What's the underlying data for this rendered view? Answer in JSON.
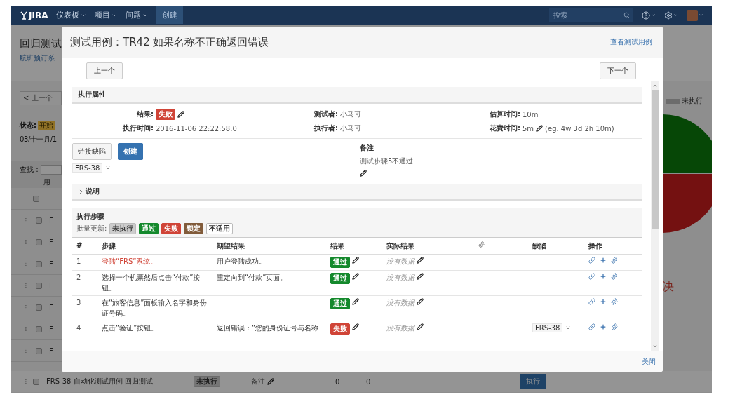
{
  "nav": {
    "logo": "JIRA",
    "menus": [
      {
        "label": "仪表板"
      },
      {
        "label": "项目"
      },
      {
        "label": "问题"
      }
    ],
    "create": "创建",
    "search": {
      "placeholder": "搜索"
    }
  },
  "page": {
    "title": "回归测试",
    "subtitle": "航班预订系",
    "prev": "< 上一个",
    "status_label": "状态:",
    "status": "开始",
    "date": "03/十一月/1",
    "find_label": "查找：",
    "find_hint": "用",
    "header_checked": false,
    "rows": [
      {
        "label": "F",
        "checked": false
      },
      {
        "label": "F",
        "checked": false
      },
      {
        "label": "F",
        "checked": false
      },
      {
        "label": "F",
        "checked": false
      },
      {
        "label": "F",
        "checked": false
      },
      {
        "label": "F",
        "checked": false
      },
      {
        "label": "F",
        "checked": false
      }
    ],
    "last_row": {
      "checked": false,
      "name": "FRS-38 自动化测试用例-回归测试",
      "status": "未执行",
      "note": "备注",
      "count_1": "0",
      "count_2": "0",
      "action": "执行"
    },
    "legend": "未执行",
    "side_text": "决"
  },
  "modal": {
    "title": "测试用例：TR42 如果名称不正确返回错误",
    "view_link": "查看测试用例",
    "prev": "上一个",
    "next": "下一个",
    "attributes": {
      "heading": "执行属性",
      "fields": [
        {
          "label": "结果:",
          "kind": "status",
          "value": "失败",
          "color": "#d04437"
        },
        {
          "label": "测试者:",
          "kind": "text",
          "value": "小马哥"
        },
        {
          "label": "估算时间:",
          "kind": "text",
          "value": "10m"
        },
        {
          "label": "执行时间:",
          "kind": "text",
          "value": "2016-11-06 22:22:58.0"
        },
        {
          "label": "执行者:",
          "kind": "text",
          "value": "小马哥"
        },
        {
          "label": "花费时间:",
          "kind": "editable",
          "value": "5m",
          "hint": "(eg. 4w 3d 2h 10m)"
        }
      ],
      "link_defect": "链接缺陷",
      "create": "创建",
      "defects": [
        "FRS-38"
      ],
      "comment_label": "备注",
      "comment": "测试步骤5不通过"
    },
    "description": {
      "label": "说明",
      "expanded": false
    },
    "steps": {
      "heading": "执行步骤",
      "bulk_label": "批量更新:",
      "bulk": [
        {
          "label": "未执行",
          "color": "#cccccc"
        },
        {
          "label": "通过",
          "color": "#14892c"
        },
        {
          "label": "失败",
          "color": "#d04437"
        },
        {
          "label": "锁定",
          "color": "#815b3a"
        },
        {
          "label": "不适用",
          "color": "#ffffff"
        }
      ],
      "columns": [
        {
          "kind": "text",
          "label": "#"
        },
        {
          "kind": "text",
          "label": "步骤"
        },
        {
          "kind": "text",
          "label": "期望结果"
        },
        {
          "kind": "text",
          "label": "结果"
        },
        {
          "kind": "text",
          "label": "实际结果"
        },
        {
          "kind": "attachment"
        },
        {
          "kind": "text",
          "label": "缺陷"
        },
        {
          "kind": "text",
          "label": "操作"
        }
      ],
      "rows": [
        {
          "number": "1",
          "step": "登陆“FRS”系统。",
          "highlight": true,
          "expected": "用户登陆成功。",
          "result": {
            "label": "通过",
            "color": "#14892c"
          },
          "actual": "没有数据"
        },
        {
          "number": "2",
          "step": "选择一个机票然后点击“付款”按钮。",
          "highlight": false,
          "expected": "重定向到“付款”页面。",
          "result": {
            "label": "通过",
            "color": "#14892c"
          },
          "actual": "没有数据"
        },
        {
          "number": "3",
          "step": "在“旅客信息”面板输入名字和身份证号码。",
          "highlight": false,
          "result": {
            "label": "通过",
            "color": "#14892c"
          },
          "actual": "没有数据"
        },
        {
          "number": "4",
          "step": "点击“验证”按钮。",
          "highlight": false,
          "expected": "返回错误：“您的身份证号与名称",
          "result": {
            "label": "失败",
            "color": "#d04437"
          },
          "actual": "没有数据",
          "defects": [
            "FRS-38"
          ]
        }
      ]
    },
    "close": "关闭"
  }
}
